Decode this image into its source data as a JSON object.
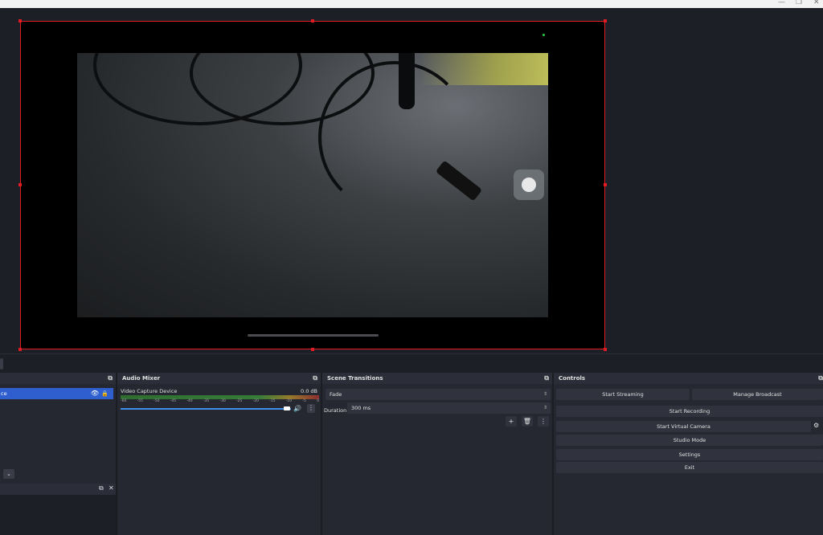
{
  "window": {
    "minimize_label": "—",
    "restore_label": "❐",
    "close_label": "✕"
  },
  "docks": {
    "sources": {
      "item_label": "ce",
      "eye_icon": "eye-icon",
      "lock_icon": "lock-icon",
      "chevron_label": "⌄"
    },
    "audio_mixer": {
      "title": "Audio Mixer",
      "channel_name": "Video Capture Device",
      "level": "0.0 dB",
      "ticks": [
        "-60",
        "-55",
        "-50",
        "-45",
        "-40",
        "-35",
        "-30",
        "-25",
        "-20",
        "-15",
        "-10",
        "-5",
        "0"
      ],
      "volume_fraction": 1.0
    },
    "scene_transitions": {
      "title": "Scene Transitions",
      "transition": "Fade",
      "duration_label": "Duration",
      "duration_value": "300 ms",
      "add_label": "+",
      "delete_label": "🗑",
      "menu_label": "⋮"
    },
    "controls": {
      "title": "Controls",
      "start_streaming": "Start Streaming",
      "manage_broadcast": "Manage Broadcast",
      "start_recording": "Start Recording",
      "start_virtual_camera": "Start Virtual Camera",
      "studio_mode": "Studio Mode",
      "settings": "Settings",
      "exit": "Exit"
    }
  },
  "colors": {
    "selection": "#2f5fce",
    "accent": "#3d8ee8",
    "bounds": "#e01b24",
    "panel": "#252830"
  }
}
